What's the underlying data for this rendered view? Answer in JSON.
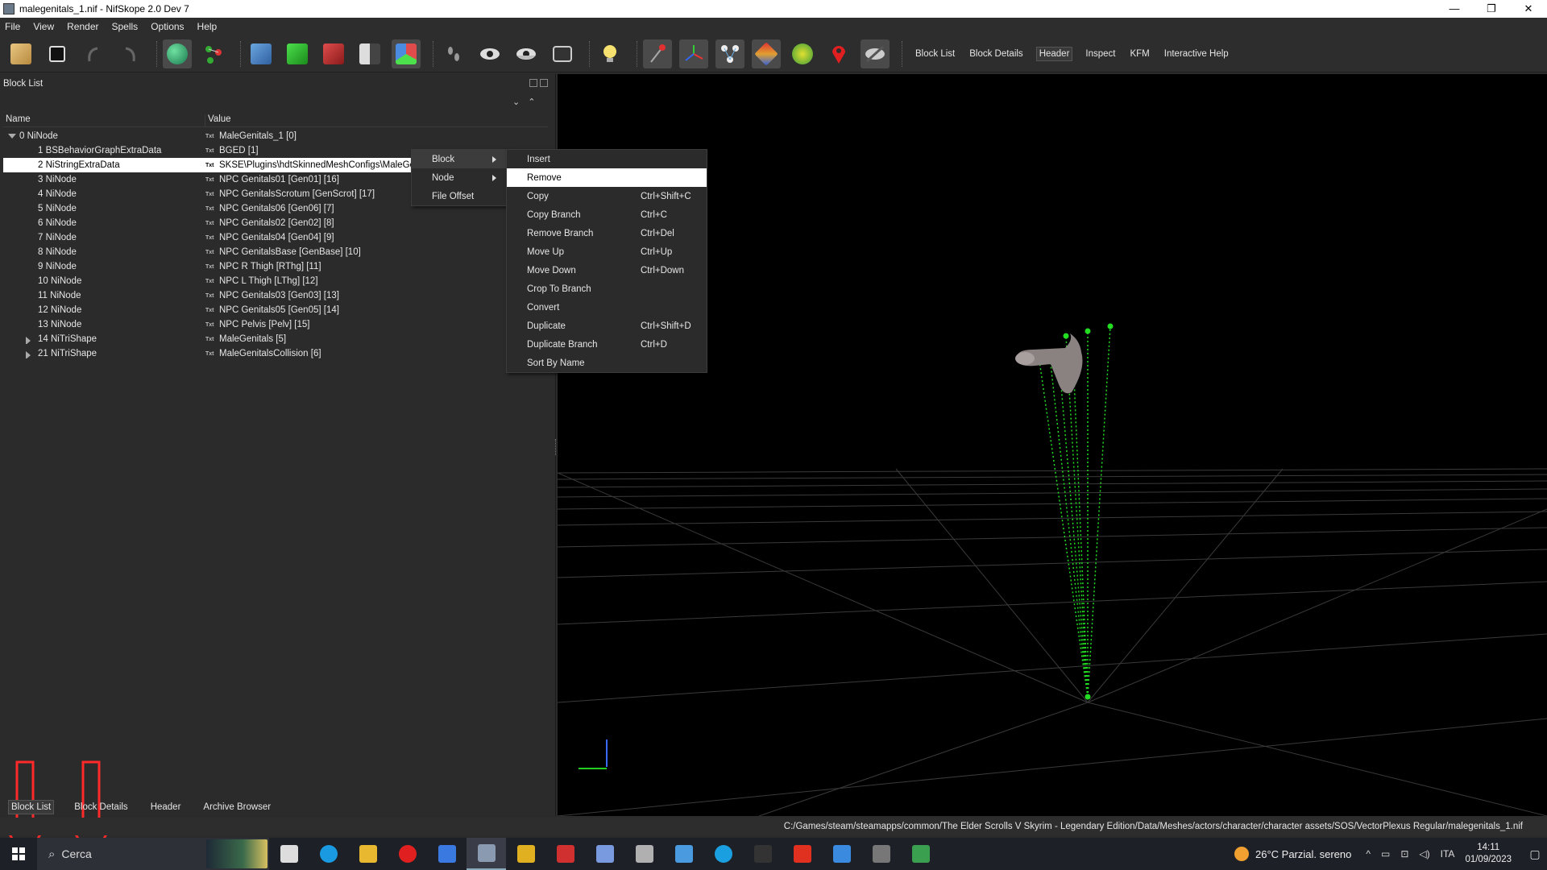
{
  "window": {
    "title": "malegenitals_1.nif - NifSkope 2.0 Dev 7",
    "controls": [
      "—",
      "❐",
      "✕"
    ]
  },
  "menubar": [
    "File",
    "View",
    "Render",
    "Spells",
    "Options",
    "Help"
  ],
  "toolbar": {
    "text_buttons": [
      {
        "label": "Block List",
        "active": true
      },
      {
        "label": "Block Details",
        "active": false
      },
      {
        "label": "Header",
        "active": true
      },
      {
        "label": "Inspect",
        "active": false
      },
      {
        "label": "KFM",
        "active": false
      },
      {
        "label": "Interactive Help",
        "active": false
      }
    ],
    "icons": [
      "load-icon",
      "save-icon",
      "undo-icon",
      "redo-icon",
      "select-object-icon",
      "select-node-icon",
      "view-walk-icon",
      "view-top-icon",
      "view-front-icon",
      "view-side-icon",
      "view-user-icon",
      "footprints-icon",
      "eye-icon",
      "eye-hidden-icon",
      "screenshot-icon",
      "light-bulb-icon",
      "axis-icon",
      "transform-icon",
      "nodes-icon",
      "gradient-icon",
      "constraint-icon",
      "marker-icon",
      "hidden-icon"
    ]
  },
  "block_list": {
    "title": "Block List",
    "columns": [
      "Name",
      "Value"
    ],
    "rows": [
      {
        "name": "0 NiNode",
        "value": "MaleGenitals_1 [0]",
        "expand": "open",
        "indent": 0
      },
      {
        "name": "1 BSBehaviorGraphExtraData",
        "value": "BGED [1]",
        "expand": "none",
        "indent": 1
      },
      {
        "name": "2 NiStringExtraData",
        "value": "SKSE\\Plugins\\hdtSkinnedMeshConfigs\\MaleGenitals.xml [2]",
        "expand": "none",
        "indent": 1,
        "selected": true
      },
      {
        "name": "3 NiNode",
        "value": "NPC Genitals01 [Gen01] [16]",
        "expand": "none",
        "indent": 1
      },
      {
        "name": "4 NiNode",
        "value": "NPC GenitalsScrotum [GenScrot] [17]",
        "expand": "none",
        "indent": 1
      },
      {
        "name": "5 NiNode",
        "value": "NPC Genitals06 [Gen06] [7]",
        "expand": "none",
        "indent": 1
      },
      {
        "name": "6 NiNode",
        "value": "NPC Genitals02 [Gen02] [8]",
        "expand": "none",
        "indent": 1
      },
      {
        "name": "7 NiNode",
        "value": "NPC Genitals04 [Gen04] [9]",
        "expand": "none",
        "indent": 1
      },
      {
        "name": "8 NiNode",
        "value": "NPC GenitalsBase [GenBase] [10]",
        "expand": "none",
        "indent": 1
      },
      {
        "name": "9 NiNode",
        "value": "NPC R Thigh [RThg] [11]",
        "expand": "none",
        "indent": 1
      },
      {
        "name": "10 NiNode",
        "value": "NPC L Thigh [LThg] [12]",
        "expand": "none",
        "indent": 1
      },
      {
        "name": "11 NiNode",
        "value": "NPC Genitals03 [Gen03] [13]",
        "expand": "none",
        "indent": 1
      },
      {
        "name": "12 NiNode",
        "value": "NPC Genitals05 [Gen05] [14]",
        "expand": "none",
        "indent": 1
      },
      {
        "name": "13 NiNode",
        "value": "NPC Pelvis [Pelv] [15]",
        "expand": "none",
        "indent": 1
      },
      {
        "name": "14 NiTriShape",
        "value": "MaleGenitals [5]",
        "expand": "closed",
        "indent": 1
      },
      {
        "name": "21 NiTriShape",
        "value": "MaleGenitalsCollision [6]",
        "expand": "closed",
        "indent": 1
      }
    ]
  },
  "bottom_tabs": [
    {
      "label": "Block List",
      "active": true
    },
    {
      "label": "Block Details",
      "active": false
    },
    {
      "label": "Header",
      "active": false
    },
    {
      "label": "Archive Browser",
      "active": false
    }
  ],
  "context_menu": {
    "main": [
      {
        "label": "Block",
        "submenu": true,
        "highlight": true
      },
      {
        "label": "Node",
        "submenu": true,
        "highlight": false
      },
      {
        "label": "File Offset",
        "submenu": false,
        "highlight": false
      }
    ],
    "block_submenu": [
      {
        "label": "Insert",
        "shortcut": "",
        "highlight": false
      },
      {
        "label": "Remove",
        "shortcut": "",
        "highlight": true
      },
      {
        "label": "Copy",
        "shortcut": "Ctrl+Shift+C",
        "highlight": false
      },
      {
        "label": "Copy Branch",
        "shortcut": "Ctrl+C",
        "highlight": false
      },
      {
        "label": "Remove Branch",
        "shortcut": "Ctrl+Del",
        "highlight": false
      },
      {
        "label": "Move Up",
        "shortcut": "Ctrl+Up",
        "highlight": false
      },
      {
        "label": "Move Down",
        "shortcut": "Ctrl+Down",
        "highlight": false
      },
      {
        "label": "Crop To Branch",
        "shortcut": "",
        "highlight": false
      },
      {
        "label": "Convert",
        "shortcut": "",
        "highlight": false
      },
      {
        "label": "Duplicate",
        "shortcut": "Ctrl+Shift+D",
        "highlight": false
      },
      {
        "label": "Duplicate Branch",
        "shortcut": "Ctrl+D",
        "highlight": false
      },
      {
        "label": "Sort By Name",
        "shortcut": "",
        "highlight": false
      }
    ]
  },
  "status": {
    "path": "C:/Games/steam/steamapps/common/The Elder Scrolls V Skyrim - Legendary Edition/Data/Meshes/actors/character/character assets/SOS/VectorPlexus Regular/malegenitals_1.nif"
  },
  "taskbar": {
    "search_placeholder": "Cerca",
    "weather": "26°C  Parzial. sereno",
    "language": "ITA",
    "time": "14:11",
    "date": "01/09/2023",
    "apps": [
      "task-view-icon",
      "edge-icon",
      "file-explorer-icon",
      "opera-icon",
      "store-icon",
      "nifskope-icon",
      "archive-icon",
      "gear-red-icon",
      "feather-icon",
      "mod-organizer-icon",
      "paint-icon",
      "skype-icon",
      "terminal-icon",
      "flash-icon",
      "window-icon",
      "arrow-app-icon",
      "chart-app-icon"
    ]
  },
  "colors": {
    "accent_green": "#22dd22",
    "annotation_red": "#ff2a2a",
    "selection": "#ffffff"
  }
}
